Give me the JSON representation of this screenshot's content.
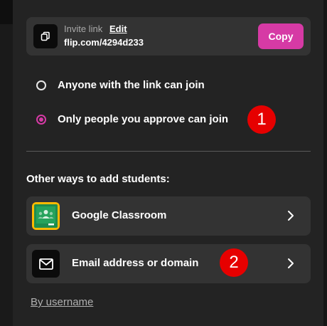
{
  "invite": {
    "label": "Invite link",
    "edit_label": "Edit",
    "url": "flip.com/4294d233",
    "copy_label": "Copy"
  },
  "join_options": [
    {
      "label": "Anyone with the link can join",
      "checked": false
    },
    {
      "label": "Only people you approve can join",
      "checked": true
    }
  ],
  "badges": [
    "1",
    "2"
  ],
  "other_ways": {
    "title": "Other ways to add students:",
    "items": [
      {
        "label": "Google Classroom",
        "icon": "google-classroom-icon"
      },
      {
        "label": "Email address or domain",
        "icon": "envelope-icon"
      }
    ],
    "by_username": "By username"
  },
  "colors": {
    "accent": "#d63aa5",
    "badge": "#e60000",
    "panel": "#232323",
    "card": "#333333"
  }
}
